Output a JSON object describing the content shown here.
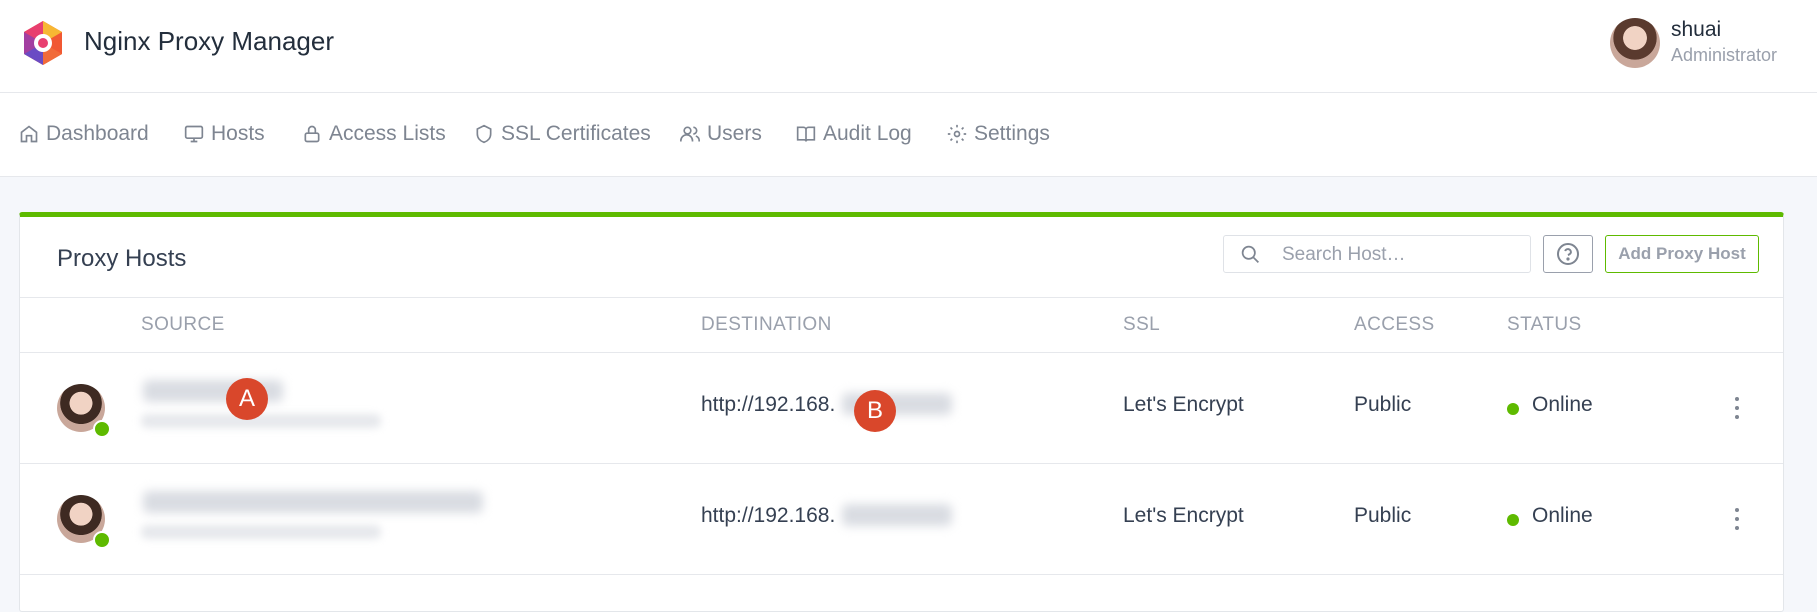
{
  "app": {
    "title": "Nginx Proxy Manager",
    "accent_color": "#5eba00"
  },
  "user": {
    "name": "shuai",
    "role": "Administrator"
  },
  "nav": [
    {
      "label": "Dashboard",
      "icon": "home-icon"
    },
    {
      "label": "Hosts",
      "icon": "monitor-icon"
    },
    {
      "label": "Access Lists",
      "icon": "lock-icon"
    },
    {
      "label": "SSL Certificates",
      "icon": "shield-icon"
    },
    {
      "label": "Users",
      "icon": "users-icon"
    },
    {
      "label": "Audit Log",
      "icon": "book-icon"
    },
    {
      "label": "Settings",
      "icon": "gear-icon"
    }
  ],
  "card": {
    "title": "Proxy Hosts",
    "search_placeholder": "Search Host…",
    "help_icon": "question-circle-icon",
    "add_button": "Add Proxy Host",
    "columns": [
      "SOURCE",
      "DESTINATION",
      "SSL",
      "ACCESS",
      "STATUS"
    ]
  },
  "rows": [
    {
      "destination": "http://192.168.",
      "ssl": "Let's Encrypt",
      "access": "Public",
      "status": "Online"
    },
    {
      "destination": "http://192.168.",
      "ssl": "Let's Encrypt",
      "access": "Public",
      "status": "Online"
    }
  ],
  "markers": [
    "A",
    "B"
  ]
}
